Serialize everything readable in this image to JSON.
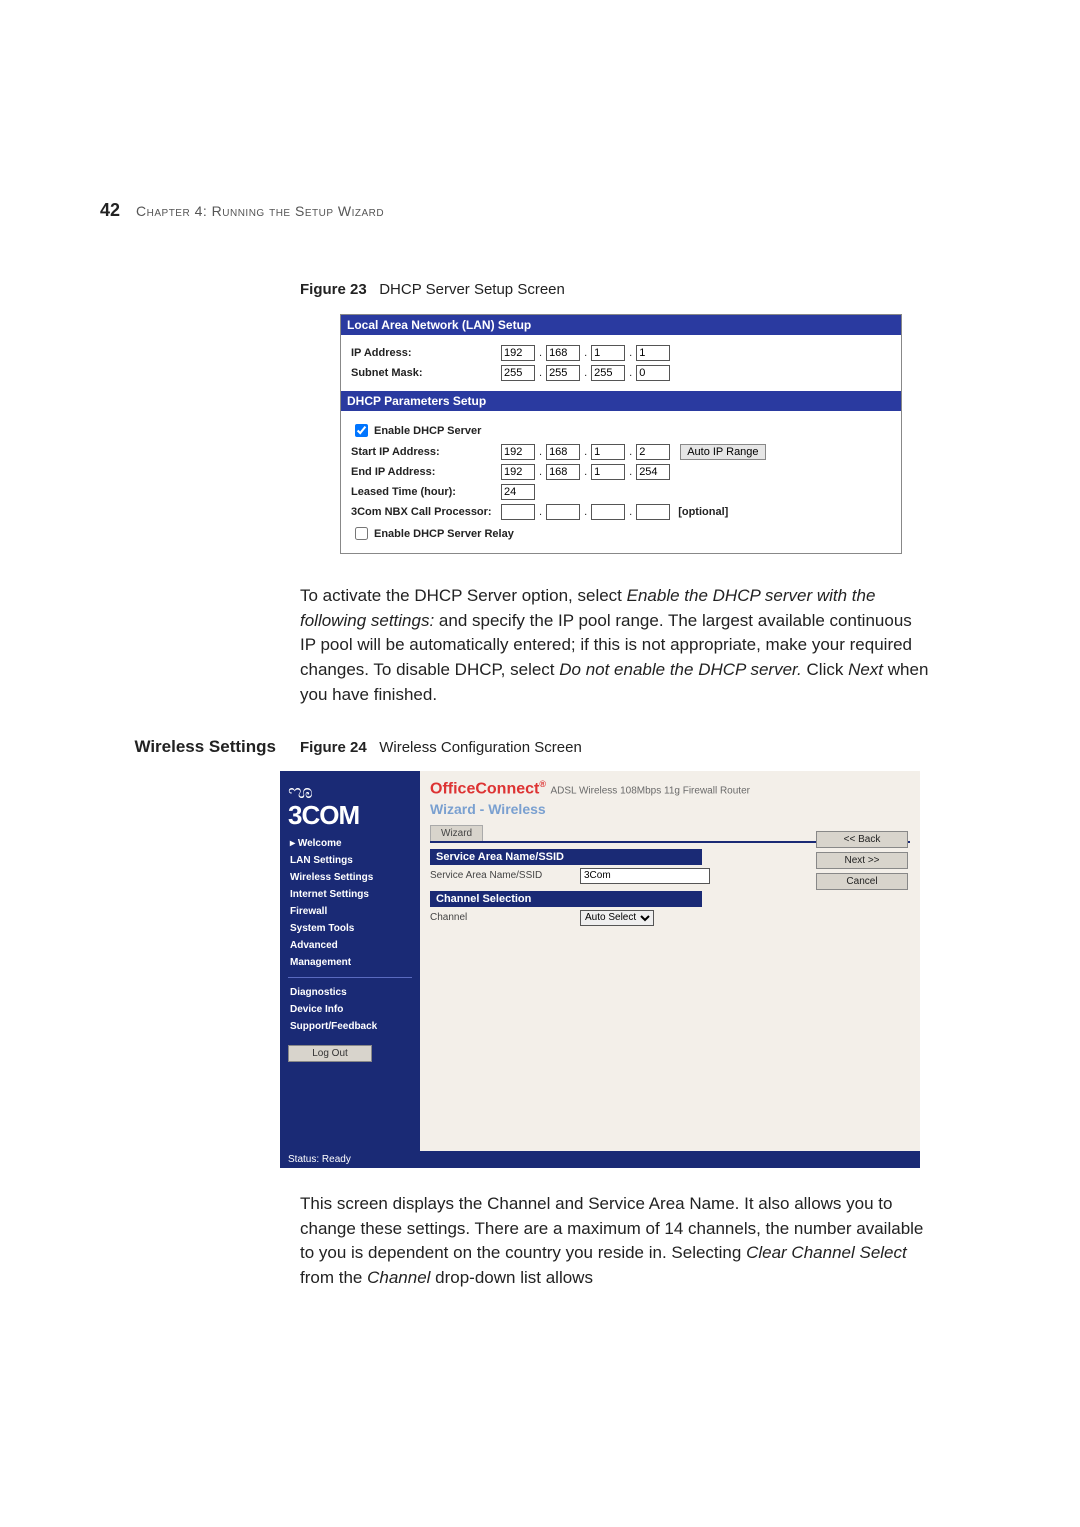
{
  "header": {
    "page_number": "42",
    "chapter_line": "Chapter 4: Running the Setup Wizard"
  },
  "figure23": {
    "caption_label": "Figure 23",
    "caption_text": "DHCP Server Setup Screen",
    "lan_title": "Local Area Network (LAN) Setup",
    "ip_address_label": "IP Address:",
    "ip_address": [
      "192",
      "168",
      "1",
      "1"
    ],
    "subnet_label": "Subnet Mask:",
    "subnet": [
      "255",
      "255",
      "255",
      "0"
    ],
    "dhcp_title": "DHCP Parameters Setup",
    "enable_dhcp_label": "Enable DHCP Server",
    "enable_dhcp_checked": true,
    "start_ip_label": "Start IP Address:",
    "start_ip": [
      "192",
      "168",
      "1",
      "2"
    ],
    "auto_ip_button": "Auto IP Range",
    "end_ip_label": "End IP Address:",
    "end_ip": [
      "192",
      "168",
      "1",
      "254"
    ],
    "leased_label": "Leased Time (hour):",
    "leased_value": "24",
    "nbx_label": "3Com NBX Call Processor:",
    "nbx_ip": [
      "",
      "",
      "",
      ""
    ],
    "optional_text": "[optional]",
    "relay_label": "Enable DHCP Server Relay",
    "relay_checked": false
  },
  "para1": {
    "t1": "To activate the DHCP Server option, select ",
    "i1": "Enable the DHCP server with the following settings:",
    "t2": " and specify the IP pool range. The largest available continuous IP pool will be automatically entered; if this is not appropriate, make your required changes. To disable DHCP, select ",
    "i2": "Do not enable the DHCP server.",
    "t3": " Click ",
    "i3": "Next",
    "t4": " when you have finished."
  },
  "section_heading": "Wireless Settings",
  "figure24": {
    "caption_label": "Figure 24",
    "caption_text": "Wireless Configuration Screen",
    "logo_text": "3COM",
    "brand": "OfficeConnect",
    "brand_sub": "ADSL Wireless 108Mbps 11g Firewall Router",
    "subtitle": "Wizard - Wireless",
    "tab": "Wizard",
    "nav": [
      "Welcome",
      "LAN Settings",
      "Wireless Settings",
      "Internet Settings",
      "Firewall",
      "System Tools",
      "Advanced",
      "Management"
    ],
    "nav_lower": [
      "Diagnostics",
      "Device Info",
      "Support/Feedback"
    ],
    "logout": "Log Out",
    "ssid_head": "Service Area Name/SSID",
    "ssid_label": "Service Area Name/SSID",
    "ssid_value": "3Com",
    "chan_head": "Channel Selection",
    "chan_label": "Channel",
    "chan_value": "Auto Select",
    "btn_back": "<< Back",
    "btn_next": "Next >>",
    "btn_cancel": "Cancel",
    "status": "Status: Ready"
  },
  "para2": {
    "t1": "This screen displays the Channel and Service Area Name. It also allows you to change these settings. There are a maximum of 14 channels, the number available to you is dependent on the country you reside in. Selecting ",
    "i1": "Clear Channel Select",
    "t2": " from the ",
    "i2": "Channel",
    "t3": " drop-down list allows"
  }
}
